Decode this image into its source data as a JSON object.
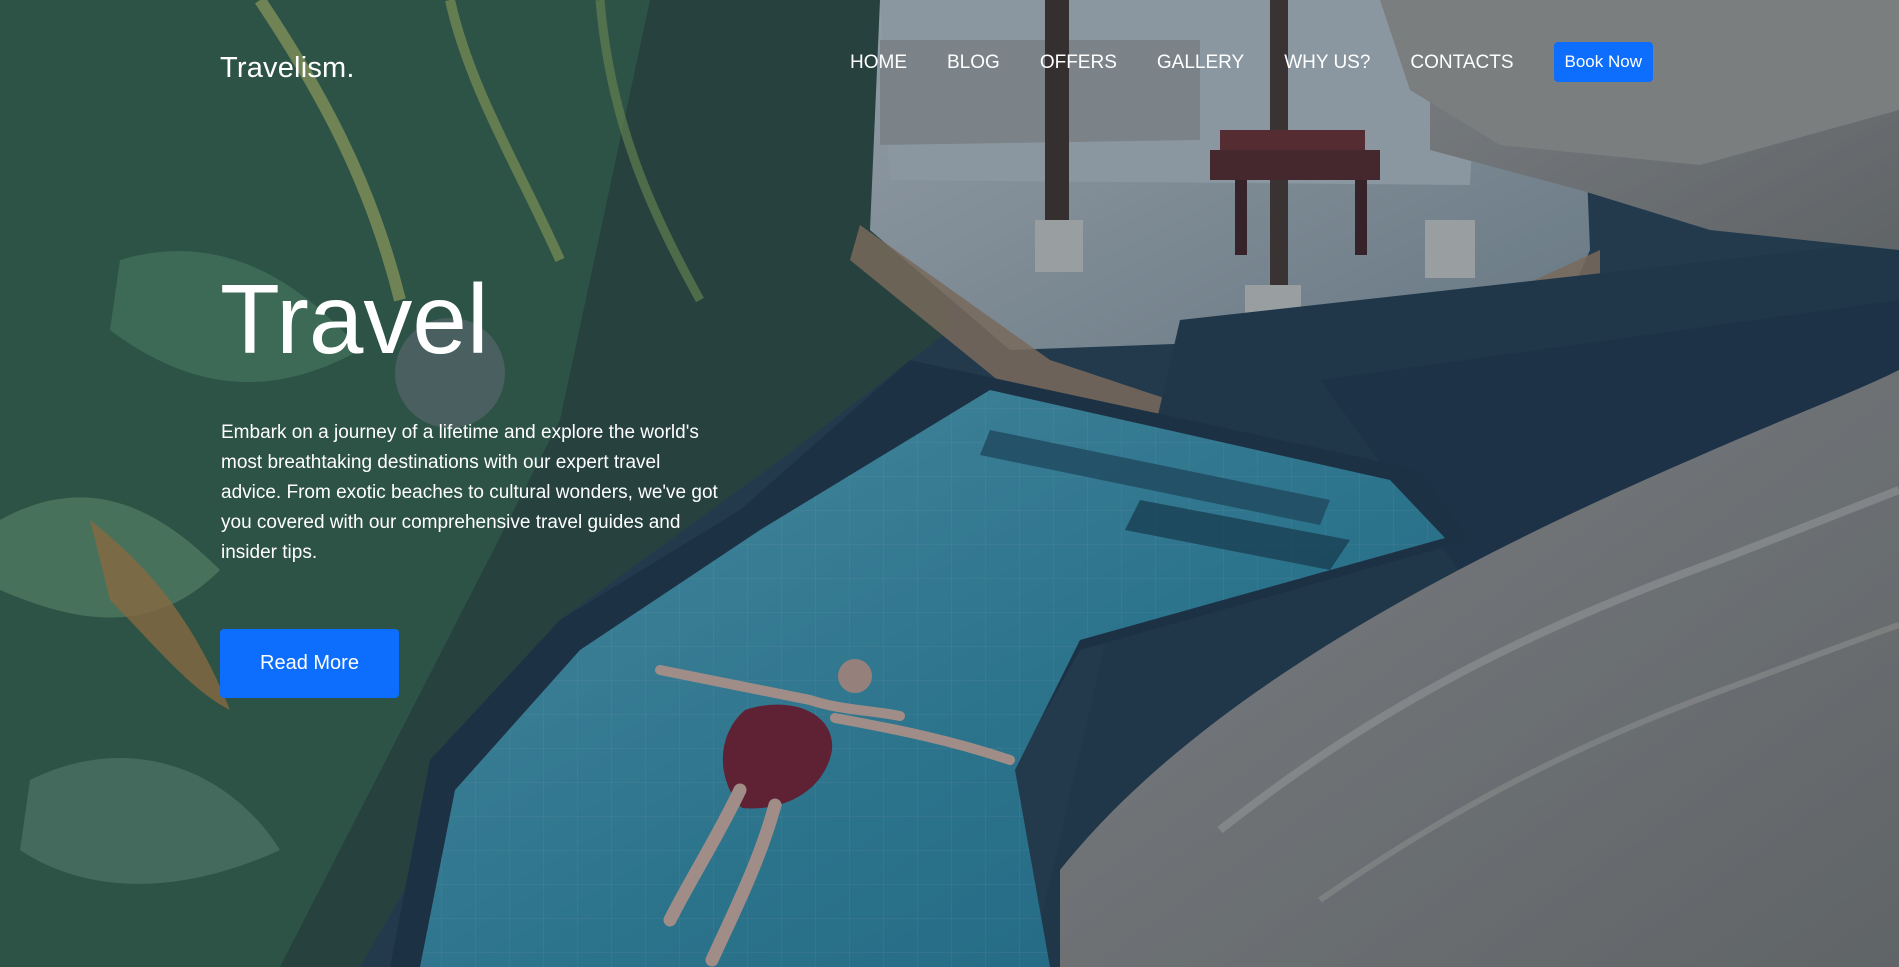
{
  "header": {
    "brand": "Travelism.",
    "nav": [
      "HOME",
      "BLOG",
      "OFFERS",
      "GALLERY",
      "WHY US?",
      "CONTACTS"
    ],
    "cta": "Book Now"
  },
  "hero": {
    "title": "Travel",
    "description": "Embark on a journey of a lifetime and explore the world's most breathtaking destinations with our expert travel advice. From exotic beaches to cultural wonders, we've got you covered with our comprehensive travel guides and insider tips.",
    "button": "Read More"
  },
  "colors": {
    "accent": "#0d6efd",
    "text": "#ffffff",
    "overlay": "#12263e"
  }
}
